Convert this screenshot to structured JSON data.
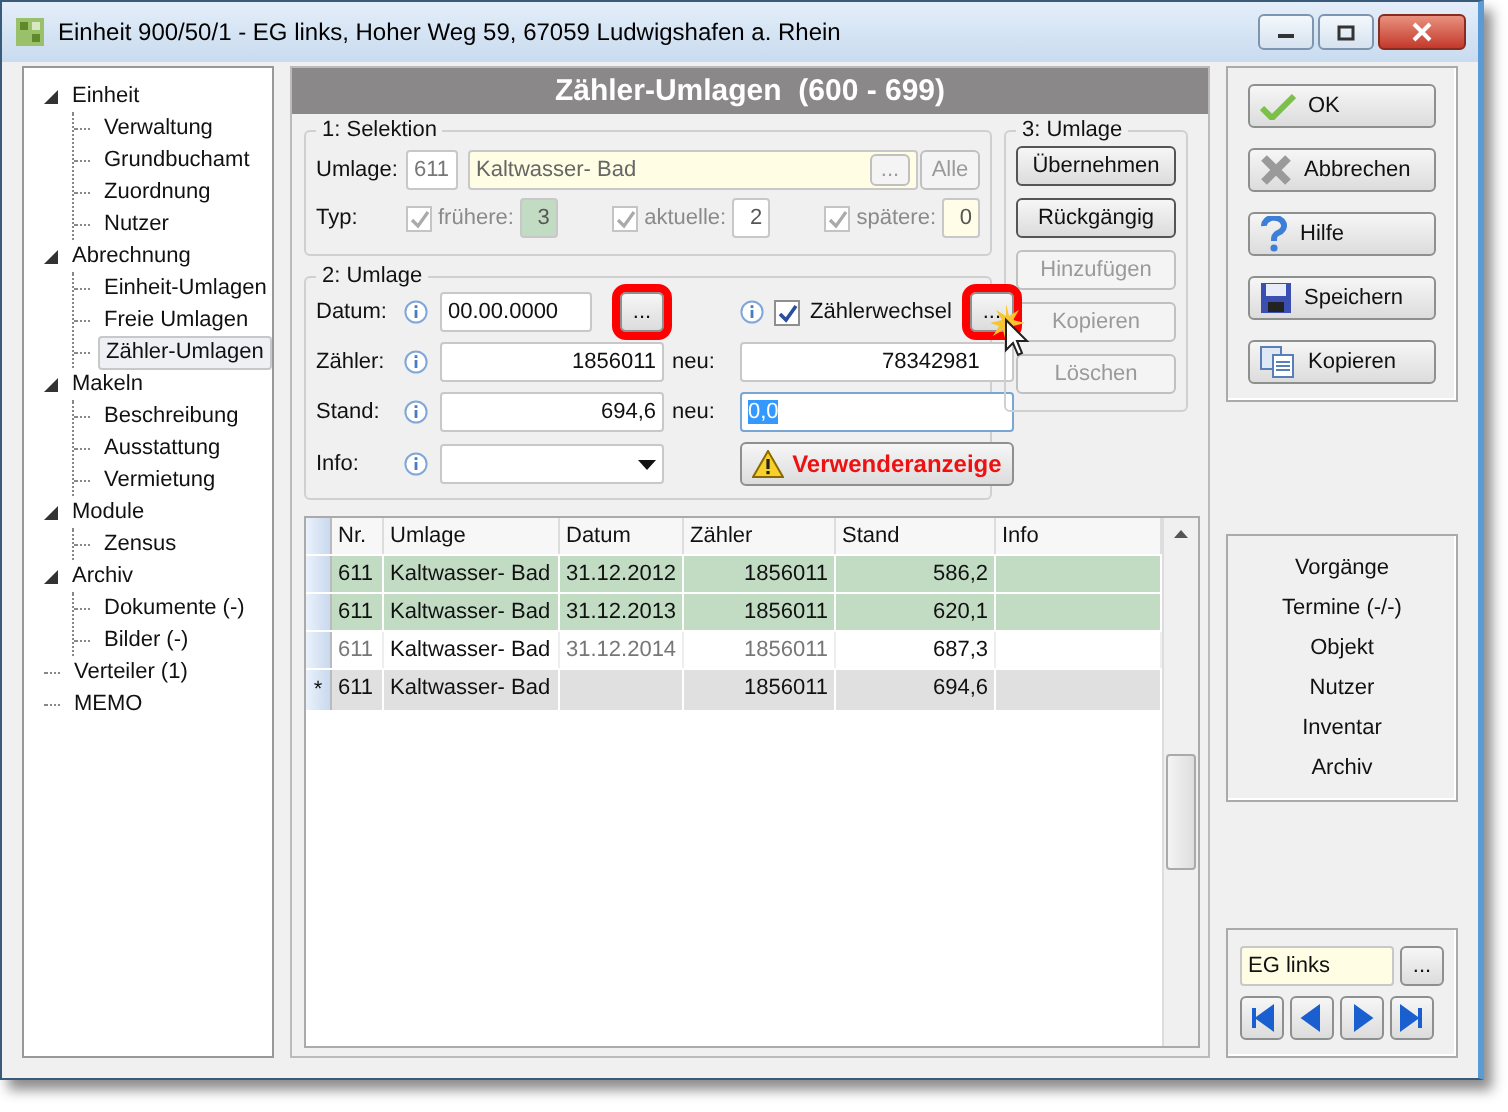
{
  "window": {
    "title": "Einheit 900/50/1 - EG links, Hoher Weg 59, 67059 Ludwigshafen a. Rhein"
  },
  "tree": [
    {
      "label": "Einheit",
      "expanded": true,
      "selected": false,
      "children": [
        {
          "label": "Verwaltung",
          "selected": false
        },
        {
          "label": "Grundbuchamt",
          "selected": false
        },
        {
          "label": "Zuordnung",
          "selected": false
        },
        {
          "label": "Nutzer",
          "selected": false
        }
      ]
    },
    {
      "label": "Abrechnung",
      "expanded": true,
      "selected": false,
      "children": [
        {
          "label": "Einheit-Umlagen",
          "selected": false
        },
        {
          "label": "Freie Umlagen",
          "selected": false
        },
        {
          "label": "Zähler-Umlagen",
          "selected": true
        }
      ]
    },
    {
      "label": "Makeln",
      "expanded": true,
      "selected": false,
      "children": [
        {
          "label": "Beschreibung",
          "selected": false
        },
        {
          "label": "Ausstattung",
          "selected": false
        },
        {
          "label": "Vermietung",
          "selected": false
        }
      ]
    },
    {
      "label": "Module",
      "expanded": true,
      "selected": false,
      "children": [
        {
          "label": "Zensus",
          "selected": false
        }
      ]
    },
    {
      "label": "Archiv",
      "expanded": true,
      "selected": false,
      "children": [
        {
          "label": "Dokumente (-)",
          "selected": false
        },
        {
          "label": "Bilder (-)",
          "selected": false
        }
      ]
    },
    {
      "label": "Verteiler (1)",
      "selected": false
    },
    {
      "label": "MEMO",
      "selected": false
    }
  ],
  "header": "Zähler-Umlagen  (600 - 699)",
  "selection": {
    "title": "1: Selektion",
    "umlage_label": "Umlage:",
    "umlage_code": "611",
    "umlage_name": "Kaltwasser- Bad",
    "browse_button": "...",
    "all_button": "Alle",
    "typ_label": "Typ:",
    "types": [
      {
        "label": "frühere:",
        "checked": true,
        "count": "3",
        "color": "#c2dcc4"
      },
      {
        "label": "aktuelle:",
        "checked": true,
        "count": "2",
        "color": "#ffffff"
      },
      {
        "label": "spätere:",
        "checked": true,
        "count": "0",
        "color": "#fffde8"
      }
    ]
  },
  "umlage": {
    "title": "2: Umlage",
    "datum_label": "Datum:",
    "datum": "00.00.0000",
    "datum_button": {
      "label": "...",
      "highlighted": true
    },
    "zaehlerwechsel": {
      "label": "Zählerwechsel",
      "checked": true
    },
    "wechsel_button": {
      "label": "...",
      "highlighted": true
    },
    "zaehler_label": "Zähler:",
    "zaehler": "1856011",
    "neu_zaehler_label": "neu:",
    "neu_zaehler": "78342981",
    "stand_label": "Stand:",
    "stand": "694,6",
    "neu_stand_label": "neu:",
    "neu_stand": "0,0",
    "info_label": "Info:",
    "warning_button": "Verwenderanzeige"
  },
  "actions": {
    "title": "3: Umlage",
    "buttons": [
      {
        "label": "Übernehmen",
        "disabled": false
      },
      {
        "label": "Rückgängig",
        "disabled": false
      },
      {
        "label": "Hinzufügen",
        "disabled": true
      },
      {
        "label": "Kopieren",
        "disabled": true
      },
      {
        "label": "Löschen",
        "disabled": true
      }
    ]
  },
  "table": {
    "columns": [
      "Nr.",
      "Umlage",
      "Datum",
      "Zähler",
      "Stand",
      "Info"
    ],
    "rows": [
      {
        "kind": "billed",
        "nr": "611",
        "umlage": "Kaltwasser- Bad",
        "datum": "31.12.2012",
        "zaehler": "1856011",
        "stand": "586,2"
      },
      {
        "kind": "billed",
        "nr": "611",
        "umlage": "Kaltwasser- Bad",
        "datum": "31.12.2013",
        "zaehler": "1856011",
        "stand": "620,1"
      },
      {
        "kind": "open",
        "nr": "611",
        "umlage": "Kaltwasser- Bad",
        "datum": "31.12.2014",
        "zaehler": "1856011",
        "stand": "687,3"
      },
      {
        "kind": "new",
        "marker": "*",
        "nr": "611",
        "umlage": "Kaltwasser- Bad",
        "zaehler": "1856011",
        "stand": "694,6"
      }
    ]
  },
  "buttons": [
    {
      "kind": "ok",
      "label": "OK"
    },
    {
      "kind": "cancel",
      "label": "Abbrechen"
    },
    {
      "kind": "help",
      "label": "Hilfe"
    },
    {
      "kind": "save",
      "label": "Speichern"
    },
    {
      "kind": "copy",
      "label": "Kopieren"
    }
  ],
  "links": [
    "Vorgänge",
    "Termine (-/-)",
    "Objekt",
    "Nutzer",
    "Inventar",
    "Archiv"
  ],
  "navigator": {
    "value": "EG links",
    "browse_button": "...",
    "buttons": [
      {
        "kind": "first"
      },
      {
        "kind": "prev"
      },
      {
        "kind": "next"
      },
      {
        "kind": "last"
      }
    ]
  }
}
